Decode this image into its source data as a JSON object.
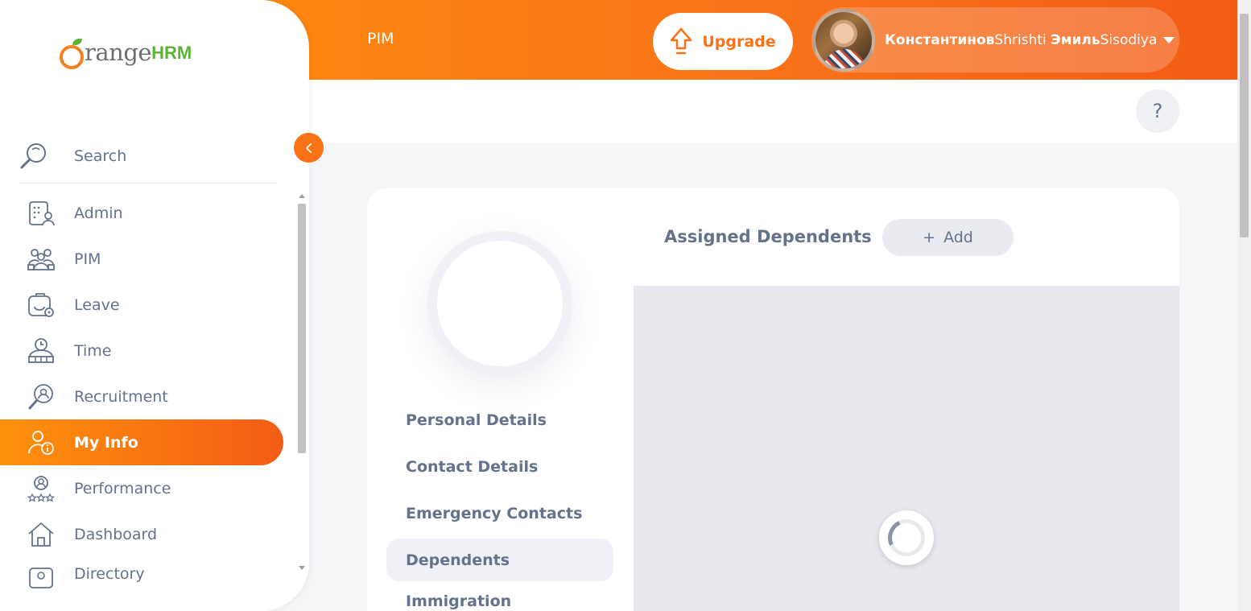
{
  "header": {
    "module_title": "PIM",
    "upgrade_label": "Upgrade",
    "user_first_bold": "Константинов",
    "user_first_rest": "Shrishti ",
    "user_last_bold": "Эмиль",
    "user_last_rest": "Sisodiya"
  },
  "help_label": "?",
  "sidebar": {
    "logo_text": "range",
    "logo_hrm": "HRM",
    "search_label": "Search",
    "items": [
      {
        "label": "Admin",
        "icon": "admin-icon"
      },
      {
        "label": "PIM",
        "icon": "pim-icon"
      },
      {
        "label": "Leave",
        "icon": "leave-icon"
      },
      {
        "label": "Time",
        "icon": "time-icon"
      },
      {
        "label": "Recruitment",
        "icon": "recruitment-icon"
      },
      {
        "label": "My Info",
        "icon": "my-info-icon",
        "active": true
      },
      {
        "label": "Performance",
        "icon": "performance-icon"
      },
      {
        "label": "Dashboard",
        "icon": "dashboard-icon"
      },
      {
        "label": "Directory",
        "icon": "directory-icon"
      }
    ]
  },
  "profile_tabs": [
    {
      "label": "Personal Details"
    },
    {
      "label": "Contact Details"
    },
    {
      "label": "Emergency Contacts"
    },
    {
      "label": "Dependents",
      "active": true
    },
    {
      "label": "Immigration"
    }
  ],
  "dependents": {
    "title": "Assigned Dependents",
    "add_label": "Add",
    "add_icon": "+"
  },
  "colors": {
    "brand_orange": "#f97316",
    "text_gray": "#64728c"
  }
}
